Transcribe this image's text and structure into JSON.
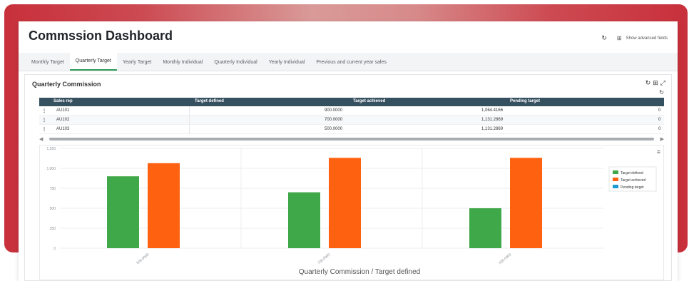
{
  "page": {
    "title": "Commssion Dashboard",
    "advanced_label": "Show advanced fields"
  },
  "tabs": [
    {
      "label": "Monthly Target",
      "active": false
    },
    {
      "label": "Quarterly Target",
      "active": true
    },
    {
      "label": "Yearly Target",
      "active": false
    },
    {
      "label": "Monthly Individual",
      "active": false
    },
    {
      "label": "Quarterly Individual",
      "active": false
    },
    {
      "label": "Yearly Individual",
      "active": false
    },
    {
      "label": "Previous and current year sales",
      "active": false
    }
  ],
  "section": {
    "title": "Quarterly Commission"
  },
  "table": {
    "columns": [
      "Sales rep",
      "Target defined",
      "Target achieved",
      "Pending target"
    ],
    "rows": [
      {
        "rep": "AU101",
        "defined": "900.0000",
        "achieved": "1,064.4166",
        "pending": "0"
      },
      {
        "rep": "AU102",
        "defined": "700.0000",
        "achieved": "1,131.2869",
        "pending": "0"
      },
      {
        "rep": "AU103",
        "defined": "500.0000",
        "achieved": "1,131.2869",
        "pending": "0"
      }
    ]
  },
  "chart_data": {
    "type": "bar",
    "categories": [
      "900.0000",
      "700.0000",
      "500.0000"
    ],
    "series": [
      {
        "name": "Target defined",
        "values": [
          900,
          700,
          500
        ],
        "color": "#3fa848"
      },
      {
        "name": "Target achieved",
        "values": [
          1064.4166,
          1131.2869,
          1131.2869
        ],
        "color": "#fe6211"
      },
      {
        "name": "Pending target",
        "values": [
          0,
          0,
          0
        ],
        "color": "#1d9bd1"
      }
    ],
    "yticks": [
      "0",
      "250",
      "500",
      "750",
      "1,000",
      "1,250"
    ],
    "ylim": [
      0,
      1250
    ],
    "xlabel": "Quarterly Commission / Target defined",
    "ylabel": "",
    "grid": true,
    "legend_position": "right"
  },
  "colors": {
    "accent": "#2f9d57",
    "table_header": "#35505f",
    "banner": "#c8303b"
  },
  "icons": {
    "refresh": "refresh-icon",
    "fullscreen": "fullscreen-icon",
    "grid": "grid-icon",
    "menu": "hamburger-icon"
  }
}
